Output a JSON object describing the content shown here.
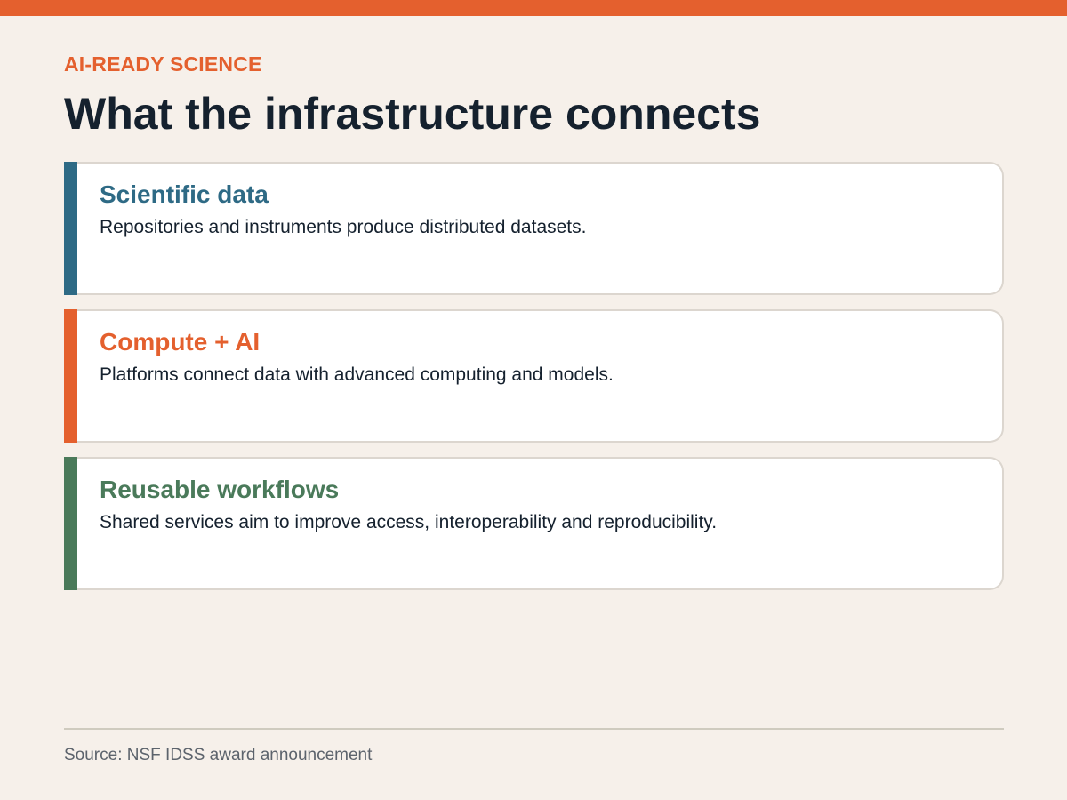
{
  "colors": {
    "background": "#f6f0ea",
    "top_bar": "#e4602e",
    "eyebrow": "#e4602e",
    "title": "#15212e",
    "card_border": "#dcd6cf"
  },
  "header": {
    "eyebrow": "AI-READY SCIENCE",
    "title": "What the infrastructure connects"
  },
  "cards": [
    {
      "title": "Scientific data",
      "text": "Repositories and instruments produce distributed datasets.",
      "accent_color": "#2e6a85"
    },
    {
      "title": "Compute + AI",
      "text": "Platforms connect data with advanced computing and models.",
      "accent_color": "#e4602e"
    },
    {
      "title": "Reusable workflows",
      "text": "Shared services aim to improve access, interoperability and reproducibility.",
      "accent_color": "#4a7a5a"
    }
  ],
  "footer": {
    "source": "Source: NSF IDSS award announcement"
  }
}
